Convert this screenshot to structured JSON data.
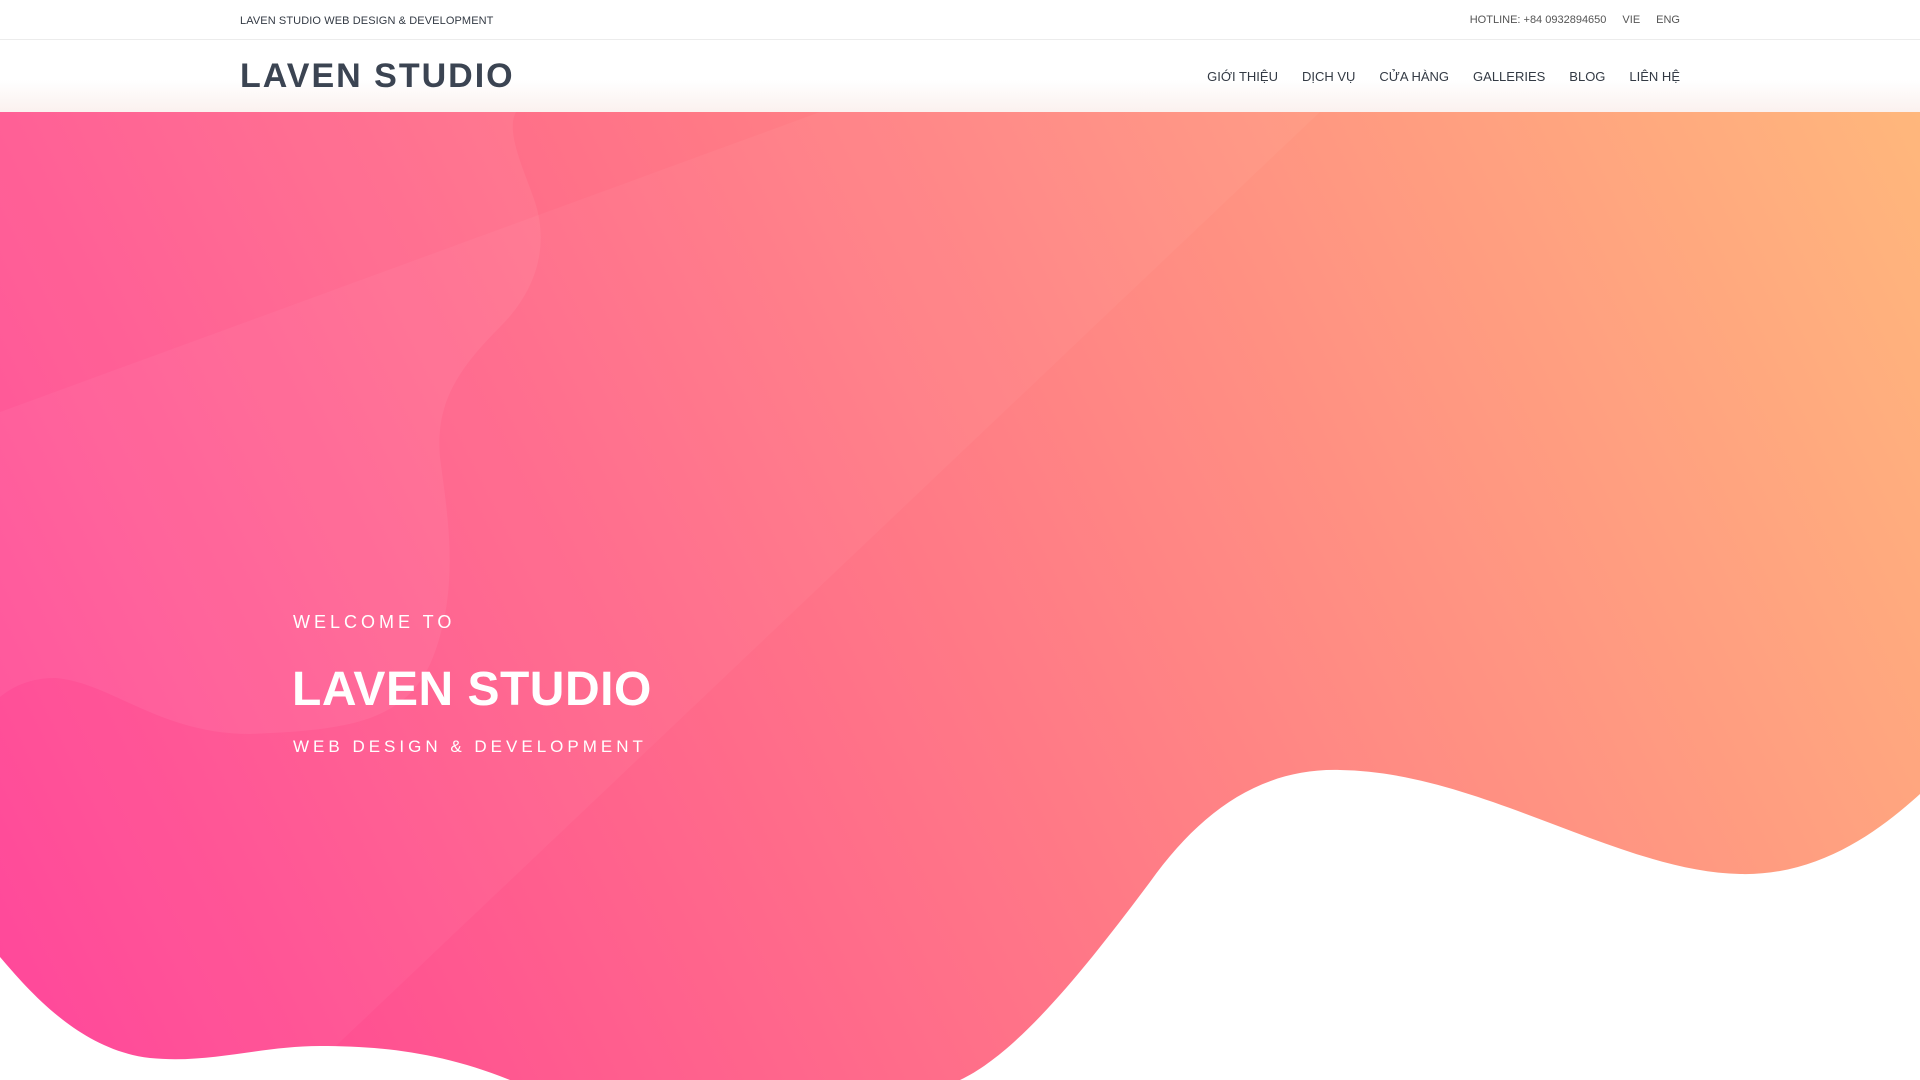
{
  "topbar": {
    "tagline": "LAVEN STUDIO WEB DESIGN & DEVELOPMENT",
    "hotline": "HOTLINE: +84 0932894650",
    "lang_vie": "VIE",
    "lang_eng": "ENG"
  },
  "header": {
    "logo": "LAVEN STUDIO",
    "nav": [
      "GIỚI THIỆU",
      "DỊCH VỤ",
      "CỬA HÀNG",
      "GALLERIES",
      "BLOG",
      "LIÊN HỆ"
    ]
  },
  "hero": {
    "welcome": "WELCOME TO",
    "title": "LAVEN STUDIO",
    "subtitle": "WEB DESIGN & DEVELOPMENT"
  },
  "colors": {
    "gradient_start": "#ff3f97",
    "gradient_mid": "#ff7a86",
    "gradient_end": "#ffb77c",
    "logo_text": "#3b4452"
  }
}
